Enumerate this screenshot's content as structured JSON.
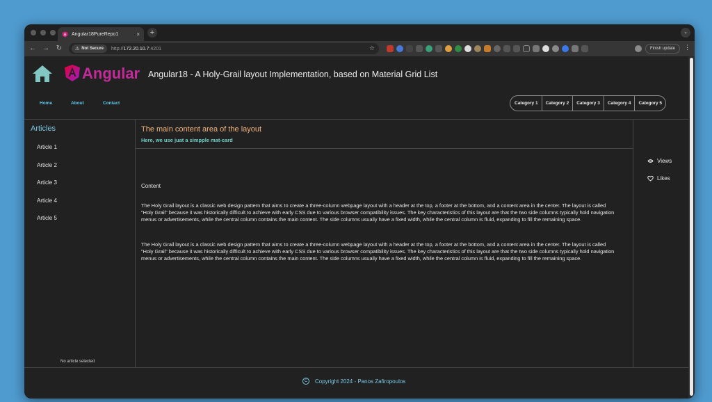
{
  "browser": {
    "tab_title": "Angular18PureRepo1",
    "tab_close": "×",
    "new_tab": "+",
    "security_label": "Not Secure",
    "url_scheme": "http://",
    "url_host": "172.20.10.7",
    "url_port": ":4201",
    "finish_update": "Finish update"
  },
  "header": {
    "logo_word": "Angular",
    "app_title": "Angular18 - A Holy-Grail layout Implementation, based on Material Grid List"
  },
  "nav": {
    "links": [
      "Home",
      "About",
      "Contact"
    ],
    "categories": [
      "Category 1",
      "Category 2",
      "Category 3",
      "Category 4",
      "Category 5"
    ]
  },
  "left": {
    "title": "Articles",
    "articles": [
      "Article 1",
      "Article 2",
      "Article 3",
      "Article 4",
      "Article 5"
    ],
    "status": "No article selected"
  },
  "main": {
    "title": "The main content area of the layout",
    "subtitle": "Here, we use juat a simpple mat-card",
    "content_label": "Content",
    "paragraphs": [
      "The Holy Grail layout is a classic web design pattern that aims to create a three-column webpage layout with a header at the top, a footer at the bottom, and a content area in the center. The layout is called \"Holy Grail\" because it was historically difficult to achieve with early CSS due to various browser compatibility issues. The key characteristics of this layout are that the two side columns typically hold navigation menus or advertisements, while the central column contains the main content. The side columns usually have a fixed width, while the central column is fluid, expanding to fill the remaining space.",
      "The Holy Grail layout is a classic web design pattern that aims to create a three-column webpage layout with a header at the top, a footer at the bottom, and a content area in the center. The layout is called \"Holy Grail\" because it was historically difficult to achieve with early CSS due to various browser compatibility issues. The key characteristics of this layout are that the two side columns typically hold navigation menus or advertisements, while the central column contains the main content. The side columns usually have a fixed width, while the central column is fluid, expanding to fill the remaining space."
    ]
  },
  "right": {
    "views": "Views",
    "likes": "Likes",
    "views_icon": "eye-icon",
    "likes_icon": "heart-outline-icon"
  },
  "footer": {
    "copyright_symbol": "C",
    "text": "Copyright 2024 - Panos Zafiropoulos"
  },
  "colors": {
    "page_bg": "#212121",
    "link": "#60c6e8",
    "accent_title": "#f2b47c",
    "subtitle": "#6fd0c8",
    "angular_brand": "#c52a9a",
    "home_icon": "#83c7c2"
  }
}
